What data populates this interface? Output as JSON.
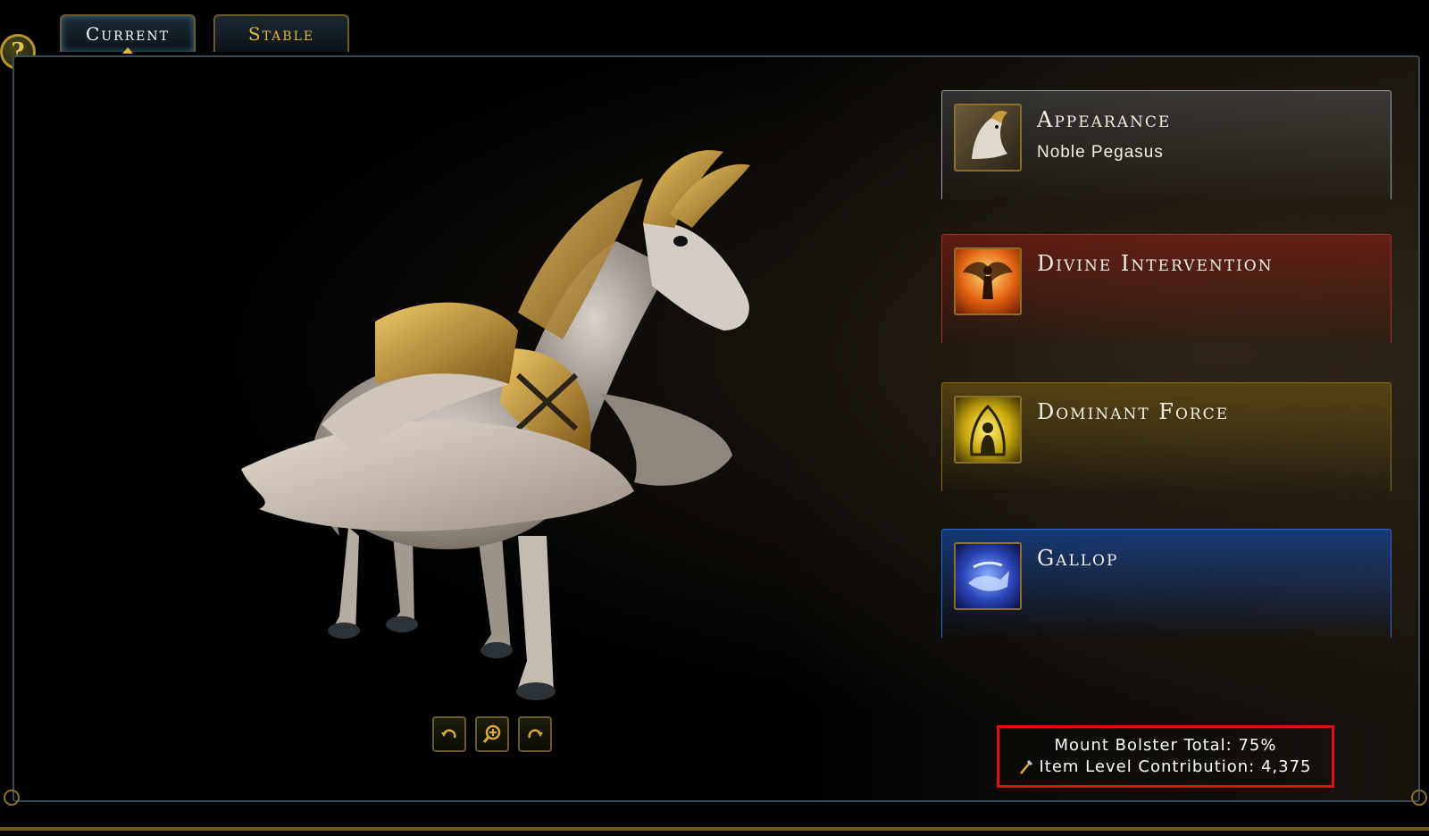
{
  "tabs": [
    {
      "label": "Current",
      "active": true
    },
    {
      "label": "Stable",
      "active": false
    }
  ],
  "help": {
    "symbol": "?"
  },
  "mount": {
    "name": "Noble Pegasus"
  },
  "panels": {
    "appearance": {
      "title": "Appearance",
      "subtitle": "Noble Pegasus",
      "color": "#9aa2a8"
    },
    "divine": {
      "title": "Divine Intervention",
      "color": "#a33224"
    },
    "dominant": {
      "title": "Dominant Force",
      "color": "#8a6a12"
    },
    "gallop": {
      "title": "Gallop",
      "color": "#2a6acc"
    }
  },
  "view_controls": [
    "rotate-left-icon",
    "zoom-in-icon",
    "rotate-right-icon"
  ],
  "stats": {
    "bolster": "Mount Bolster Total: 75%",
    "item_level": "Item Level Contribution: 4,375",
    "highlight_color": "#e01010"
  },
  "colors": {
    "gold": "#e8b43a",
    "frame": "#3a4a56"
  }
}
